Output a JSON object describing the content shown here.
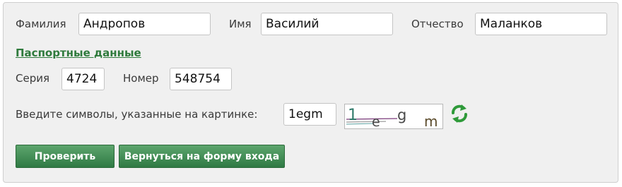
{
  "form": {
    "surname_label": "Фамилия",
    "surname_value": "Андропов",
    "name_label": "Имя",
    "name_value": "Василий",
    "patronymic_label": "Отчество",
    "patronymic_value": "Маланков",
    "passport_link": "Паспортные данные",
    "series_label": "Серия",
    "series_value": "4724",
    "number_label": "Номер",
    "number_value": "548754",
    "captcha_label": "Введите символы, указанные на картинке:",
    "captcha_value": "1egm"
  },
  "captcha_image": {
    "chars": [
      "1",
      "e",
      "g",
      "m"
    ],
    "colors": {
      "char_1": "#2f7a6a",
      "others": "#4a4a4a",
      "noise_line": "#7a3a7a"
    }
  },
  "buttons": {
    "check_label": "Проверить",
    "back_label": "Вернуться на форму входа"
  },
  "icons": {
    "refresh": "refresh-icon"
  },
  "colors": {
    "accent": "#2e7a3c",
    "button_top": "#5da56d",
    "button_bottom": "#2f7a44",
    "panel_bg": "#f0f0f0"
  }
}
